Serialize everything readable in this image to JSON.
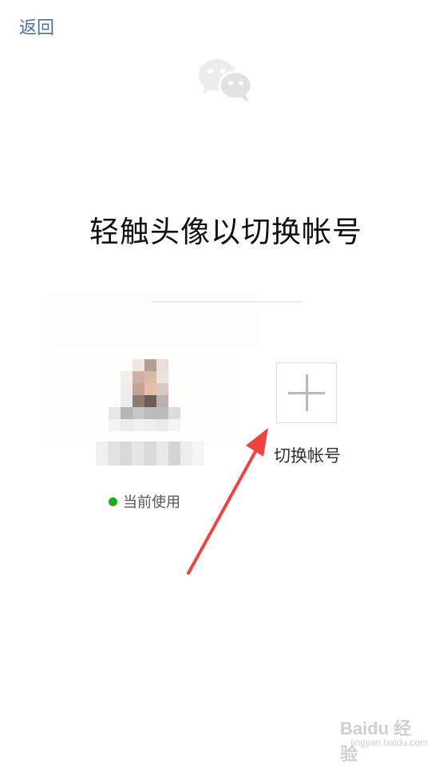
{
  "nav": {
    "back_label": "返回"
  },
  "page": {
    "title": "轻触头像以切换帐号"
  },
  "current_account": {
    "status_text": "当前使用",
    "status_color": "#1aad19"
  },
  "add_account": {
    "label": "切换帐号"
  },
  "annotation": {
    "arrow_color": "#f0423f"
  },
  "watermark": {
    "brand": "Baidu 经验",
    "url": "jingyan.baidu.com"
  },
  "icons": {
    "app_logo": "wechat-logo-icon",
    "add": "plus-icon",
    "status": "status-dot-icon"
  }
}
